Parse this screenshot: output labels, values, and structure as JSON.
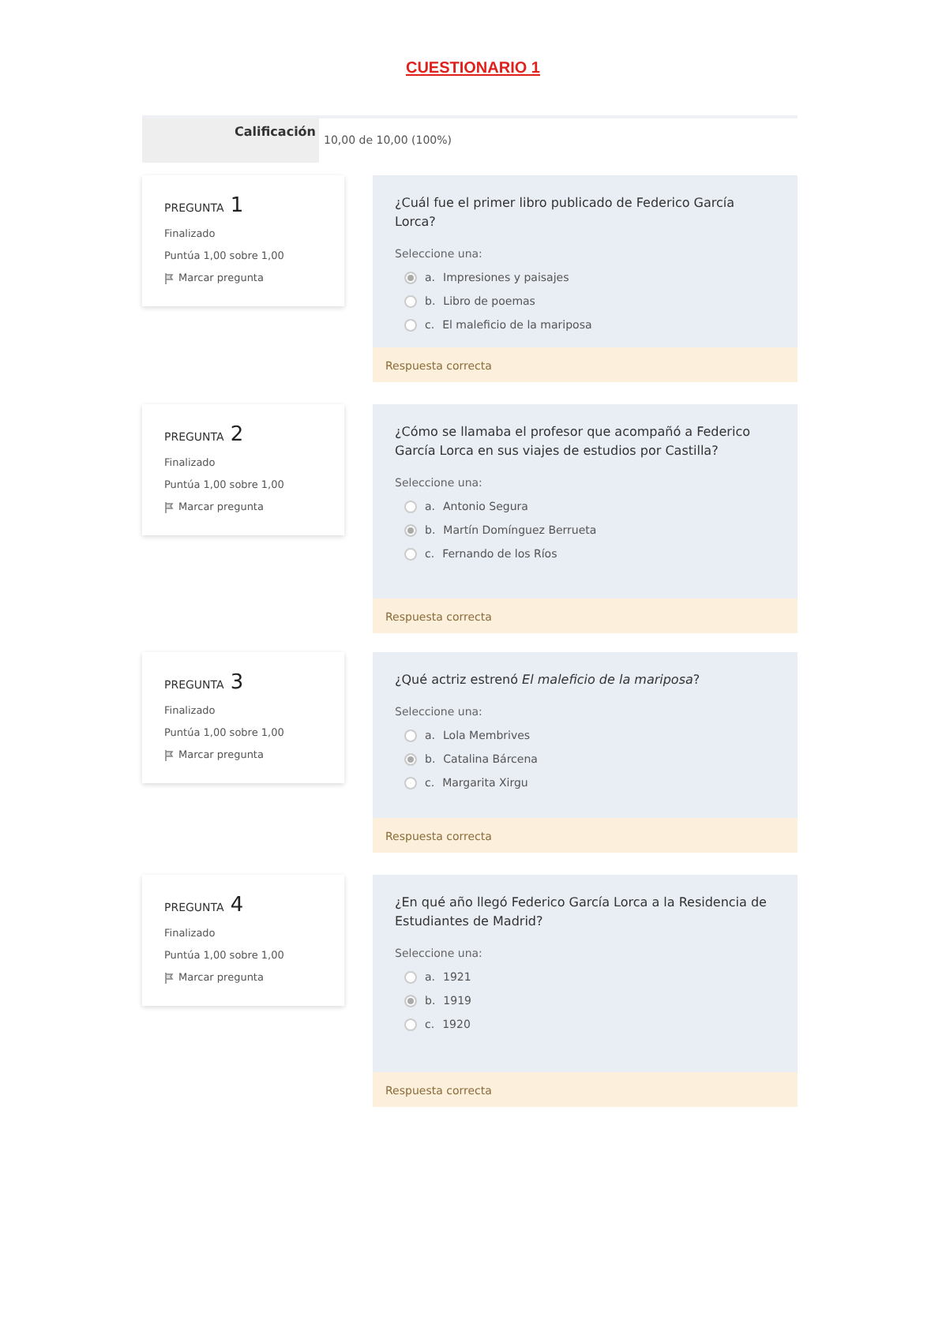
{
  "title": "CUESTIONARIO 1",
  "grade": {
    "label": "Calificación",
    "value": "10,00 de 10,00 (100%)"
  },
  "questions": [
    {
      "label": "PREGUNTA",
      "number": "1",
      "status": "Finalizado",
      "score": "Puntúa 1,00 sobre 1,00",
      "flag": "Marcar pregunta",
      "text": "¿Cuál fue el primer libro publicado de Federico García Lorca?",
      "prompt": "Seleccione una:",
      "options": [
        {
          "letter": "a.",
          "text": "Impresiones y paisajes",
          "selected": true
        },
        {
          "letter": "b.",
          "text": "Libro de poemas",
          "selected": false
        },
        {
          "letter": "c.",
          "text": "El maleficio de la mariposa",
          "selected": false
        }
      ],
      "feedback": "Respuesta correcta"
    },
    {
      "label": "PREGUNTA",
      "number": "2",
      "status": "Finalizado",
      "score": "Puntúa 1,00 sobre 1,00",
      "flag": "Marcar pregunta",
      "text": "¿Cómo se llamaba el profesor que acompañó a Federico García Lorca en sus viajes de estudios por Castilla?",
      "prompt": "Seleccione una:",
      "options": [
        {
          "letter": "a.",
          "text": "Antonio Segura",
          "selected": false
        },
        {
          "letter": "b.",
          "text": "Martín Domínguez Berrueta",
          "selected": true
        },
        {
          "letter": "c.",
          "text": "Fernando de los Ríos",
          "selected": false
        }
      ],
      "feedback": "Respuesta correcta"
    },
    {
      "label": "PREGUNTA",
      "number": "3",
      "status": "Finalizado",
      "score": "Puntúa 1,00 sobre 1,00",
      "flag": "Marcar pregunta",
      "text": "¿Qué actriz estrenó *El maleficio de la mariposa*?",
      "prompt": "Seleccione una:",
      "options": [
        {
          "letter": "a.",
          "text": "Lola Membrives",
          "selected": false
        },
        {
          "letter": "b.",
          "text": "Catalina Bárcena",
          "selected": true
        },
        {
          "letter": "c.",
          "text": "Margarita Xirgu",
          "selected": false
        }
      ],
      "feedback": "Respuesta correcta"
    },
    {
      "label": "PREGUNTA",
      "number": "4",
      "status": "Finalizado",
      "score": "Puntúa 1,00 sobre 1,00",
      "flag": "Marcar pregunta",
      "text": "¿En qué año llegó Federico García Lorca a la Residencia de Estudiantes de Madrid?",
      "prompt": "Seleccione una:",
      "options": [
        {
          "letter": "a.",
          "text": "1921",
          "selected": false
        },
        {
          "letter": "b.",
          "text": "1919",
          "selected": true
        },
        {
          "letter": "c.",
          "text": "1920",
          "selected": false
        }
      ],
      "feedback": "Respuesta correcta"
    }
  ]
}
